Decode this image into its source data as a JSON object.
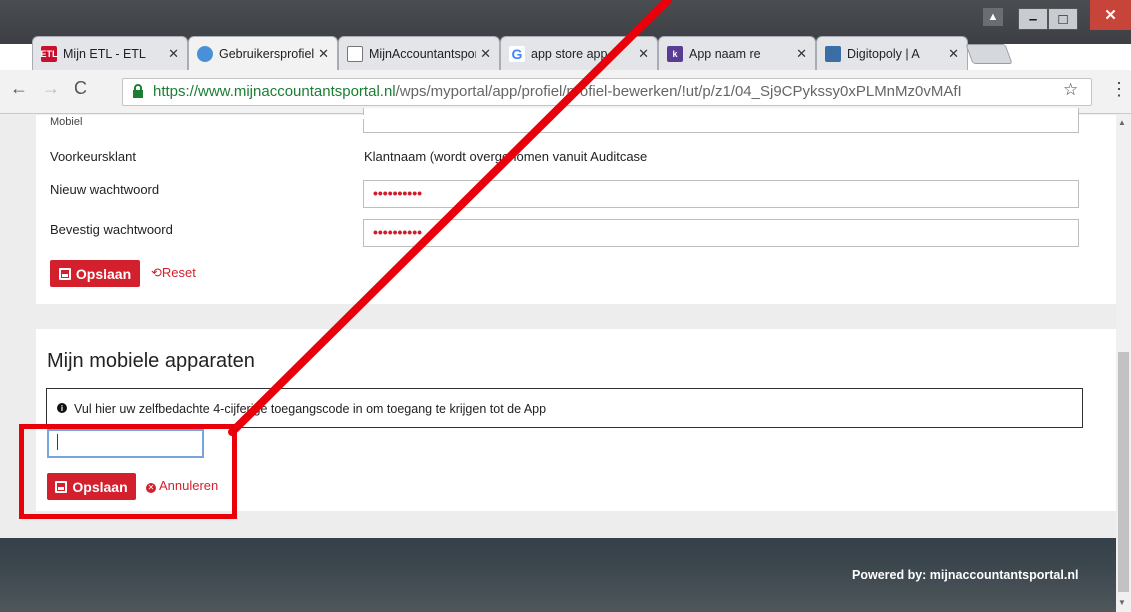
{
  "browser": {
    "tabs": [
      {
        "label": "Mijn ETL - ETL",
        "favicon": "ETL",
        "favicon_color": "#c8102e"
      },
      {
        "label": "Gebruikersprofiel",
        "favicon": "",
        "favicon_color": "#4a90d9"
      },
      {
        "label": "MijnAccountantsportal",
        "favicon": "",
        "favicon_color": "#ffffff"
      },
      {
        "label": "app store app",
        "favicon": "G",
        "favicon_color": "#4285f4"
      },
      {
        "label": "App naam re",
        "favicon": "k",
        "favicon_color": "#5b3c94"
      },
      {
        "label": "Digitopoly | A",
        "favicon": "",
        "favicon_color": "#3a6ea5"
      }
    ],
    "url_host": "https://www.mijnaccountantsportal.nl",
    "url_path": "/wps/myportal/app/profiel/profiel-bewerken/!ut/p/z1/04_Sj9CPykssy0xPLMnMz0vMAfI"
  },
  "profile_form": {
    "partial_label": "Mobiel",
    "preferred_client_label": "Voorkeursklant",
    "preferred_client_value": "Klantnaam (wordt overgenomen vanuit Auditcase",
    "new_password_label": "Nieuw wachtwoord",
    "new_password_value": "••••••••••",
    "confirm_password_label": "Bevestig wachtwoord",
    "confirm_password_value": "••••••••••",
    "save_label": "Opslaan",
    "reset_label": "Reset"
  },
  "devices": {
    "title": "Mijn mobiele apparaten",
    "info_text": "Vul hier uw zelfbedachte 4-cijferige toegangscode in om toegang te krijgen tot de App",
    "code_value": "",
    "save_label": "Opslaan",
    "cancel_label": "Annuleren"
  },
  "footer": {
    "powered_by": "Powered by: mijnaccountantsportal.nl"
  },
  "colors": {
    "accent": "#d41f2d",
    "annotation": "#e8000b"
  }
}
